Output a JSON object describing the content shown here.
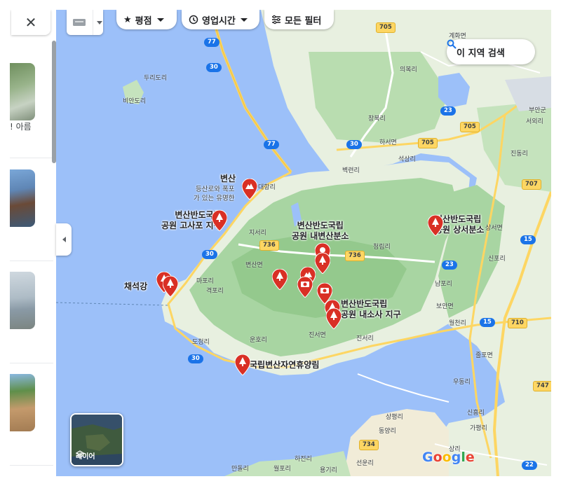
{
  "panel": {
    "close_label": "✕",
    "snippet_text": "! 아름"
  },
  "toolbar": {
    "rating_label": "평점",
    "hours_label": "영업시간",
    "filters_label": "모든 필터"
  },
  "search_area": {
    "label": "이 지역 검색"
  },
  "layers": {
    "label": "레이어"
  },
  "logo": {
    "text": "Google"
  },
  "places": [
    {
      "id": "byeonsan",
      "name": "변산",
      "desc_lines": [
        "등산로와 폭포",
        "가 있는 유명한"
      ]
    },
    {
      "id": "gosapo",
      "name_lines": [
        "변산반도국립",
        "공원 고사포 지구"
      ]
    },
    {
      "id": "naebyeon",
      "name_lines": [
        "변산반도국립",
        "공원 내변산분소"
      ]
    },
    {
      "id": "sangseo",
      "name_lines": [
        "변산반도국립",
        "공원 상서분소"
      ]
    },
    {
      "id": "chaeseokgang",
      "name": "채석강"
    },
    {
      "id": "naesosa",
      "name_lines": [
        "변산반도국립",
        "공원 내소사 지구"
      ]
    },
    {
      "id": "forest",
      "name": "국립변산자연휴양림"
    }
  ],
  "towns": [
    "두리도리",
    "비안도리",
    "계화면",
    "의복리",
    "창북리",
    "부안군",
    "서외리",
    "진동리",
    "대항리",
    "벽련리",
    "석상리",
    "지서리",
    "변산면",
    "청림리",
    "하서면",
    "상서면",
    "격포리",
    "마포리",
    "운호리",
    "도청리",
    "진서면",
    "진서리",
    "보안면",
    "우동리",
    "줄포면",
    "상평리",
    "동양리",
    "하전리",
    "월포리",
    "선운리",
    "용기리",
    "만돌리",
    "신흥리",
    "가평리",
    "남포리",
    "신포리",
    "상리",
    "월천리"
  ],
  "roads": [
    "77",
    "77",
    "30",
    "30",
    "30",
    "30",
    "705",
    "705",
    "705",
    "736",
    "736",
    "707",
    "23",
    "23",
    "15",
    "15",
    "710",
    "747",
    "734",
    "22"
  ],
  "colors": {
    "water": "#9cc0f9",
    "land": "#e8f0e0",
    "park": "#a8d5a2",
    "pin": "#d93025",
    "road_yellow": "#fdd663"
  }
}
